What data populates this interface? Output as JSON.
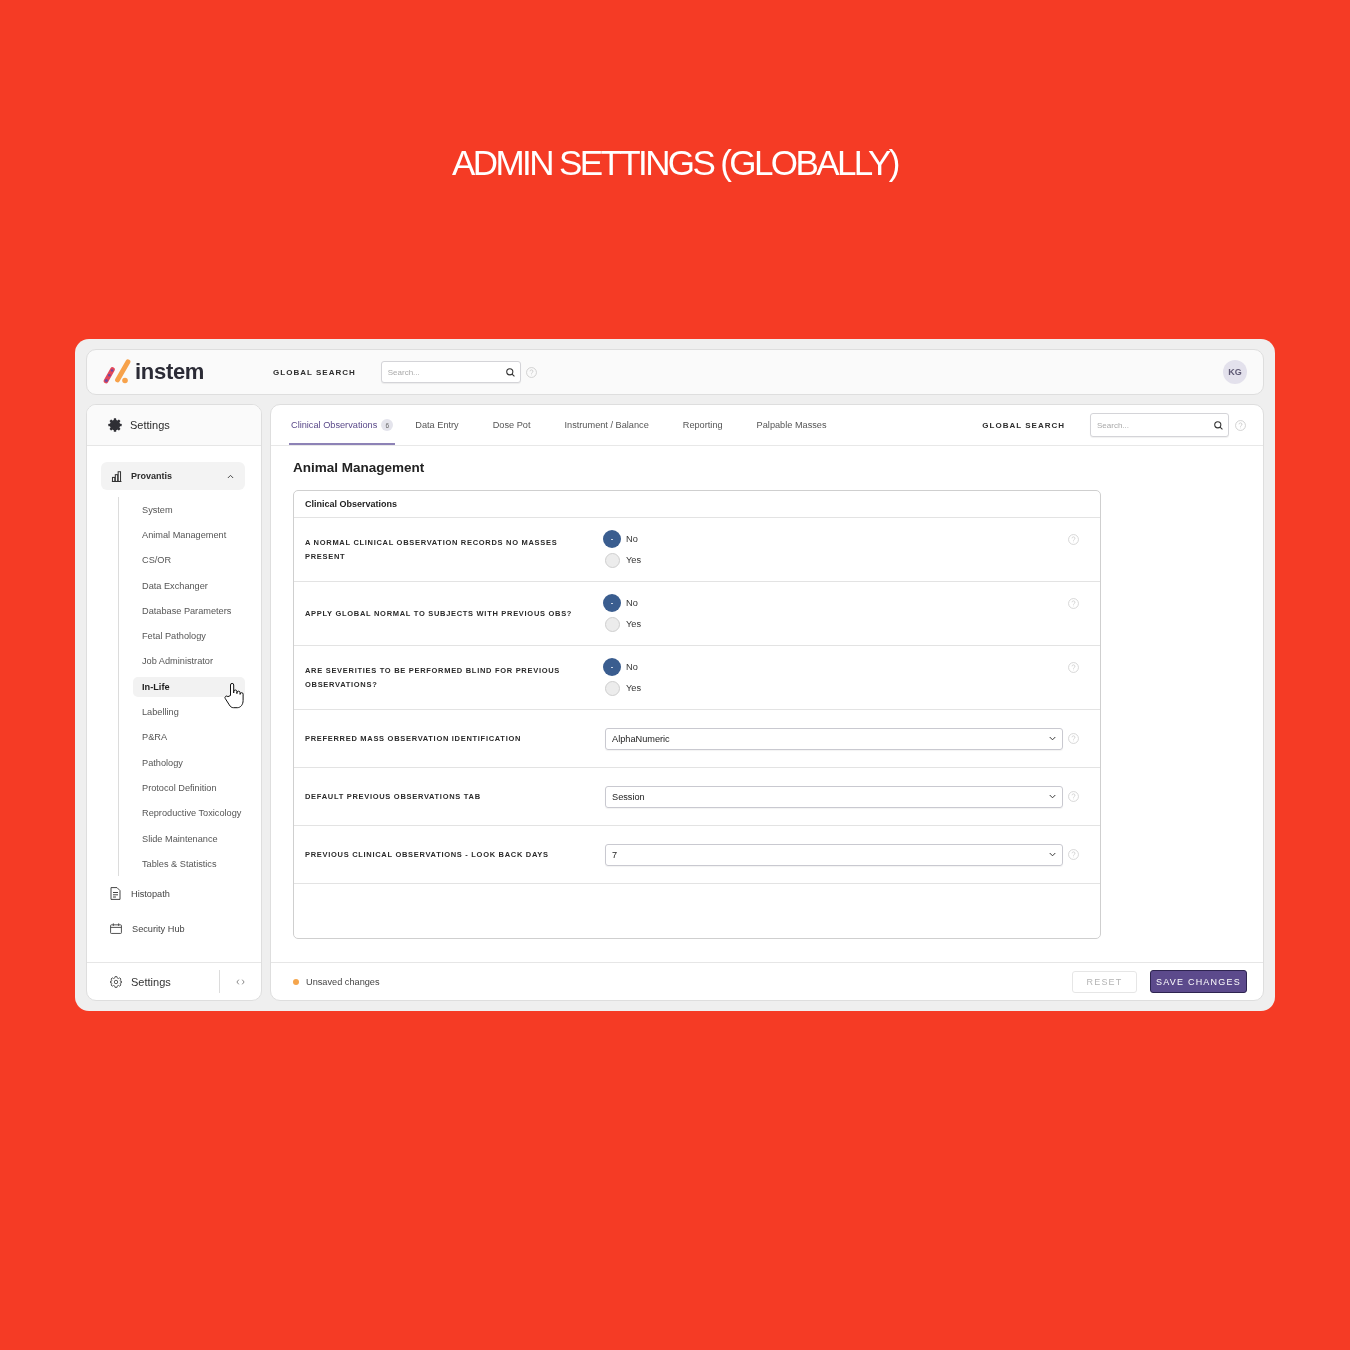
{
  "page_title": "ADMIN SETTINGS (GLOBALLY)",
  "top_bar": {
    "logo_text": "instem",
    "search_label": "GLOBAL SEARCH",
    "search": {
      "placeholder": "Search..."
    },
    "avatar": "KG"
  },
  "sidebar": {
    "title": "Settings",
    "section": {
      "label": "Provantis",
      "expanded": true,
      "children": [
        {
          "label": "System",
          "selected": false
        },
        {
          "label": "Animal Management",
          "selected": false
        },
        {
          "label": "CS/OR",
          "selected": false
        },
        {
          "label": "Data Exchanger",
          "selected": false
        },
        {
          "label": "Database Parameters",
          "selected": false
        },
        {
          "label": "Fetal Pathology",
          "selected": false
        },
        {
          "label": "Job Administrator",
          "selected": false
        },
        {
          "label": "In-Life",
          "selected": true
        },
        {
          "label": "Labelling",
          "selected": false
        },
        {
          "label": "P&RA",
          "selected": false
        },
        {
          "label": "Pathology",
          "selected": false
        },
        {
          "label": "Protocol Definition",
          "selected": false
        },
        {
          "label": "Reproductive Toxicology",
          "selected": false
        },
        {
          "label": "Slide Maintenance",
          "selected": false
        },
        {
          "label": "Tables & Statistics",
          "selected": false
        }
      ]
    },
    "links": [
      {
        "label": "Histopath"
      },
      {
        "label": "Security Hub"
      }
    ],
    "footer_label": "Settings"
  },
  "tabs": [
    {
      "label": "Clinical Observations",
      "badge": "6",
      "selected": true
    },
    {
      "label": "Data Entry",
      "selected": false
    },
    {
      "label": "Dose Pot",
      "selected": false
    },
    {
      "label": "Instrument / Balance",
      "selected": false
    },
    {
      "label": "Reporting",
      "selected": false
    },
    {
      "label": "Palpable Masses",
      "selected": false
    }
  ],
  "panel_search": {
    "label": "GLOBAL SEARCH",
    "placeholder": "Search..."
  },
  "content": {
    "heading": "Animal Management",
    "card": {
      "title": "Clinical Observations",
      "settings": [
        {
          "kind": "radio",
          "label": "A NORMAL CLINICAL OBSERVATION RECORDS NO MASSES PRESENT",
          "options": [
            {
              "label": "No",
              "selected": true
            },
            {
              "label": "Yes",
              "selected": false
            }
          ]
        },
        {
          "kind": "radio",
          "label": "APPLY GLOBAL NORMAL TO SUBJECTS WITH PREVIOUS OBS?",
          "options": [
            {
              "label": "No",
              "selected": true
            },
            {
              "label": "Yes",
              "selected": false
            }
          ]
        },
        {
          "kind": "radio",
          "label": "ARE SEVERITIES TO BE PERFORMED BLIND FOR PREVIOUS OBSERVATIONS?",
          "options": [
            {
              "label": "No",
              "selected": true
            },
            {
              "label": "Yes",
              "selected": false
            }
          ]
        },
        {
          "kind": "select",
          "label": "PREFERRED MASS OBSERVATION IDENTIFICATION",
          "value": "AlphaNumeric"
        },
        {
          "kind": "select",
          "label": "DEFAULT PREVIOUS OBSERVATIONS TAB",
          "value": "Session"
        },
        {
          "kind": "select",
          "label": "PREVIOUS CLINICAL OBSERVATIONS - LOOK BACK DAYS",
          "value": "7"
        }
      ]
    }
  },
  "footer": {
    "status": "Unsaved changes",
    "buttons": [
      {
        "label": "RESET",
        "kind": "secondary",
        "disabled": true
      },
      {
        "label": "SAVE CHANGES",
        "kind": "primary",
        "disabled": false
      }
    ]
  }
}
